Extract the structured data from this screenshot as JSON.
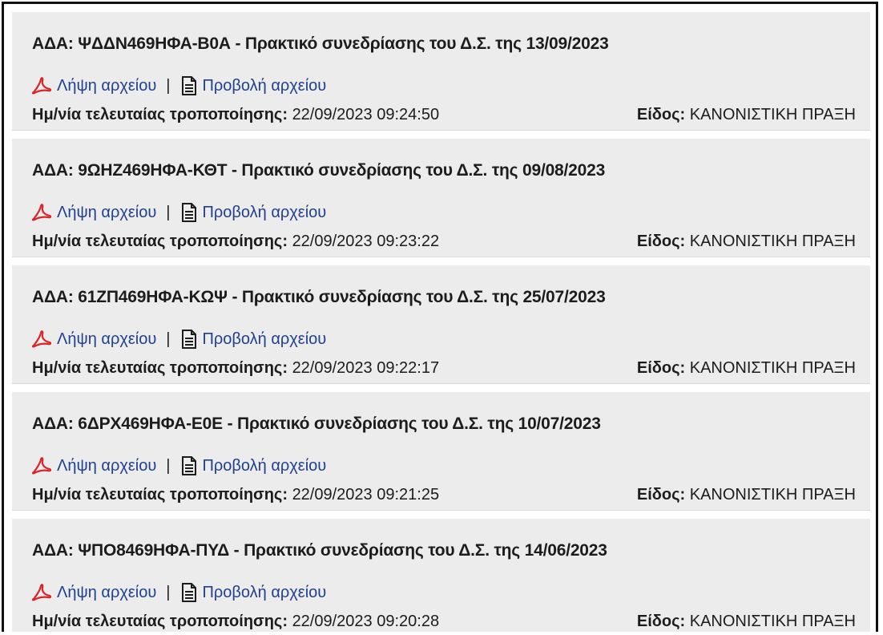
{
  "records": [
    {
      "title": "ΑΔΑ: ΨΔΔΝ469ΗΦΑ-Β0Α - Πρακτικό συνεδρίασης του Δ.Σ. της 13/09/2023",
      "download_label": "Λήψη αρχείου",
      "separator": "|",
      "view_label": "Προβολή αρχείου",
      "modified_label": "Ημ/νία τελευταίας τροποποίησης:",
      "modified_value": "22/09/2023 09:24:50",
      "kind_label": "Είδος:",
      "kind_value": "ΚΑΝΟΝΙΣΤΙΚΗ ΠΡΑΞΗ"
    },
    {
      "title": "ΑΔΑ: 9ΩΗΖ469ΗΦΑ-ΚΘΤ - Πρακτικό συνεδρίασης του Δ.Σ. της 09/08/2023",
      "download_label": "Λήψη αρχείου",
      "separator": "|",
      "view_label": "Προβολή αρχείου",
      "modified_label": "Ημ/νία τελευταίας τροποποίησης:",
      "modified_value": "22/09/2023 09:23:22",
      "kind_label": "Είδος:",
      "kind_value": "ΚΑΝΟΝΙΣΤΙΚΗ ΠΡΑΞΗ"
    },
    {
      "title": "ΑΔΑ: 61ΖΠ469ΗΦΑ-ΚΩΨ - Πρακτικό συνεδρίασης του Δ.Σ. της 25/07/2023",
      "download_label": "Λήψη αρχείου",
      "separator": "|",
      "view_label": "Προβολή αρχείου",
      "modified_label": "Ημ/νία τελευταίας τροποποίησης:",
      "modified_value": "22/09/2023 09:22:17",
      "kind_label": "Είδος:",
      "kind_value": "ΚΑΝΟΝΙΣΤΙΚΗ ΠΡΑΞΗ"
    },
    {
      "title": "ΑΔΑ: 6ΔΡΧ469ΗΦΑ-Ε0Ε - Πρακτικό συνεδρίασης του Δ.Σ. της 10/07/2023",
      "download_label": "Λήψη αρχείου",
      "separator": "|",
      "view_label": "Προβολή αρχείου",
      "modified_label": "Ημ/νία τελευταίας τροποποίησης:",
      "modified_value": "22/09/2023 09:21:25",
      "kind_label": "Είδος:",
      "kind_value": "ΚΑΝΟΝΙΣΤΙΚΗ ΠΡΑΞΗ"
    },
    {
      "title": "ΑΔΑ: ΨΠΟ8469ΗΦΑ-ΠΥΔ - Πρακτικό συνεδρίασης του Δ.Σ. της 14/06/2023",
      "download_label": "Λήψη αρχείου",
      "separator": "|",
      "view_label": "Προβολή αρχείου",
      "modified_label": "Ημ/νία τελευταίας τροποποίησης:",
      "modified_value": "22/09/2023 09:20:28",
      "kind_label": "Είδος:",
      "kind_value": "ΚΑΝΟΝΙΣΤΙΚΗ ΠΡΑΞΗ"
    }
  ],
  "icons": {
    "download": "pdf-icon",
    "view": "document-icon"
  },
  "colors": {
    "record_background": "#ececec",
    "link": "#1f3f8f",
    "pdf_icon": "#d7262b",
    "text": "#1c1c1c"
  }
}
